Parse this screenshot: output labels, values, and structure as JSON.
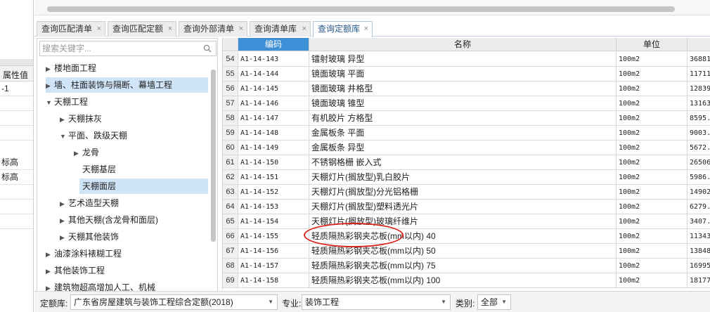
{
  "left_panel": {
    "column_header": "属性值",
    "rows": [
      "-1",
      "",
      "",
      "",
      "标高",
      "标高",
      "",
      "",
      ""
    ]
  },
  "tabs": [
    {
      "label": "查询匹配清单",
      "close": "×"
    },
    {
      "label": "查询匹配定额",
      "close": "×"
    },
    {
      "label": "查询外部清单",
      "close": "×"
    },
    {
      "label": "查询清单库",
      "close": "×"
    },
    {
      "label": "查询定额库",
      "close": "×"
    }
  ],
  "search": {
    "placeholder": "搜索关键字..."
  },
  "tree": [
    {
      "label": "楼地面工程",
      "arrow": "▶"
    },
    {
      "label": "墙、柱面装饰与隔断、幕墙工程",
      "arrow": "▶"
    },
    {
      "label": "天棚工程",
      "arrow": "▼"
    },
    {
      "label": "天棚抹灰",
      "arrow": "▶"
    },
    {
      "label": "平面、跌级天棚",
      "arrow": "▼"
    },
    {
      "label": "龙骨",
      "arrow": "▶"
    },
    {
      "label": "天棚基层",
      "arrow": ""
    },
    {
      "label": "天棚面层",
      "arrow": ""
    },
    {
      "label": "艺术造型天棚",
      "arrow": "▶"
    },
    {
      "label": "其他天棚(含龙骨和面层)",
      "arrow": "▶"
    },
    {
      "label": "天棚其他装饰",
      "arrow": "▶"
    },
    {
      "label": "油漆涂料裱糊工程",
      "arrow": "▶"
    },
    {
      "label": "其他装饰工程",
      "arrow": "▶"
    },
    {
      "label": "建筑物超高增加人工、机械",
      "arrow": "▶"
    }
  ],
  "grid": {
    "headers": {
      "code": "编码",
      "name": "名称",
      "unit": "单位"
    },
    "rows": [
      {
        "n": "54",
        "code": "A1-14-143",
        "name": "镭射玻璃 异型",
        "unit": "100m2",
        "price": "36881"
      },
      {
        "n": "55",
        "code": "A1-14-144",
        "name": "镜面玻璃 平面",
        "unit": "100m2",
        "price": "11711"
      },
      {
        "n": "56",
        "code": "A1-14-145",
        "name": "镜面玻璃 井格型",
        "unit": "100m2",
        "price": "12839"
      },
      {
        "n": "57",
        "code": "A1-14-146",
        "name": "镜面玻璃 锥型",
        "unit": "100m2",
        "price": "13163"
      },
      {
        "n": "58",
        "code": "A1-14-147",
        "name": "有机胶片 方格型",
        "unit": "100m2",
        "price": "8595.("
      },
      {
        "n": "59",
        "code": "A1-14-148",
        "name": "金属板条 平面",
        "unit": "100m2",
        "price": "9003.("
      },
      {
        "n": "60",
        "code": "A1-14-149",
        "name": "金属板条 异型",
        "unit": "100m2",
        "price": "5672."
      },
      {
        "n": "61",
        "code": "A1-14-150",
        "name": "不锈钢格栅 嵌入式",
        "unit": "100m2",
        "price": "26506"
      },
      {
        "n": "62",
        "code": "A1-14-151",
        "name": "天棚灯片(搁放型)乳白胶片",
        "unit": "100m2",
        "price": "5986.("
      },
      {
        "n": "63",
        "code": "A1-14-152",
        "name": "天棚灯片(搁放型)分光铝格栅",
        "unit": "100m2",
        "price": "14902"
      },
      {
        "n": "64",
        "code": "A1-14-153",
        "name": "天棚灯片(搁放型)塑料透光片",
        "unit": "100m2",
        "price": "6279.("
      },
      {
        "n": "65",
        "code": "A1-14-154",
        "name": "天棚灯片(搁放型)玻璃纤维片",
        "unit": "100m2",
        "price": "3407.8"
      },
      {
        "n": "66",
        "code": "A1-14-155",
        "name": "轻质隔热彩钢夹芯板(mm以内) 40",
        "unit": "100m2",
        "price": "11343"
      },
      {
        "n": "67",
        "code": "A1-14-156",
        "name": "轻质隔热彩钢夹芯板(mm以内) 50",
        "unit": "100m2",
        "price": "13848"
      },
      {
        "n": "68",
        "code": "A1-14-157",
        "name": "轻质隔热彩钢夹芯板(mm以内) 75",
        "unit": "100m2",
        "price": "16995"
      },
      {
        "n": "69",
        "code": "A1-14-158",
        "name": "轻质隔热彩钢夹芯板(mm以内) 100",
        "unit": "100m2",
        "price": "18177"
      }
    ]
  },
  "bottom": {
    "library_label": "定额库:",
    "library_value": "广东省房屋建筑与装饰工程综合定额(2018)",
    "major_label": "专业:",
    "major_value": "装饰工程",
    "category_label": "类别:",
    "category_value": "全部"
  },
  "colors": {
    "accent": "#3d8fd6",
    "highlight": "#cfe4f7",
    "annotation": "#d9241b"
  }
}
